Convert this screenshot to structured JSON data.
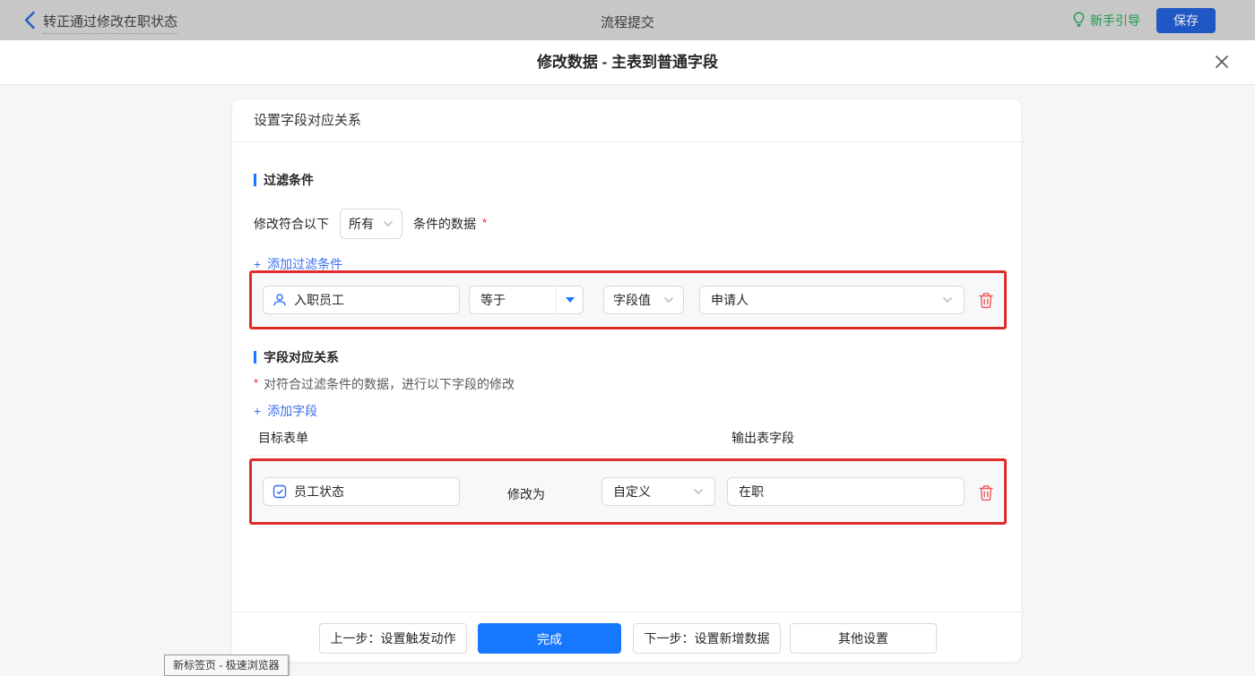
{
  "topbar": {
    "back_title": "转正通过修改在职状态",
    "center_title": "流程提交",
    "guide_label": "新手引导",
    "save_label": "保存"
  },
  "modal": {
    "title": "修改数据 - 主表到普通字段"
  },
  "card": {
    "header": "设置字段对应关系",
    "filter_section": {
      "title": "过滤条件",
      "sentence_prefix": "修改符合以下",
      "match_select_value": "所有",
      "sentence_suffix": "条件的数据",
      "required_mark": "*",
      "add_plus": "+",
      "add_text": "添加过滤条件",
      "row": {
        "field": "入职员工",
        "operator": "等于",
        "value_type": "字段值",
        "value": "申请人"
      }
    },
    "mapping_section": {
      "title": "字段对应关系",
      "required_mark": "*",
      "description": "对符合过滤条件的数据，进行以下字段的修改",
      "add_plus": "+",
      "add_text": "添加字段",
      "col_target": "目标表单",
      "col_output": "输出表字段",
      "row": {
        "field": "员工状态",
        "action_label": "修改为",
        "mode_select_value": "自定义",
        "value": "在职"
      }
    },
    "footer": {
      "prev_label": "上一步：设置触发动作",
      "done_label": "完成",
      "next_label": "下一步：设置新增数据",
      "other_label": "其他设置"
    }
  },
  "status_tooltip": "新标签页 - 极速浏览器",
  "colors": {
    "accent": "#1677ff",
    "link": "#3a6ff2",
    "annotation_red": "#e02b2b",
    "danger": "#f4565c",
    "guide_green": "#1a9a4d",
    "save_button": "#1f57c4",
    "topbar_dimmed": "#c7c7c7"
  }
}
